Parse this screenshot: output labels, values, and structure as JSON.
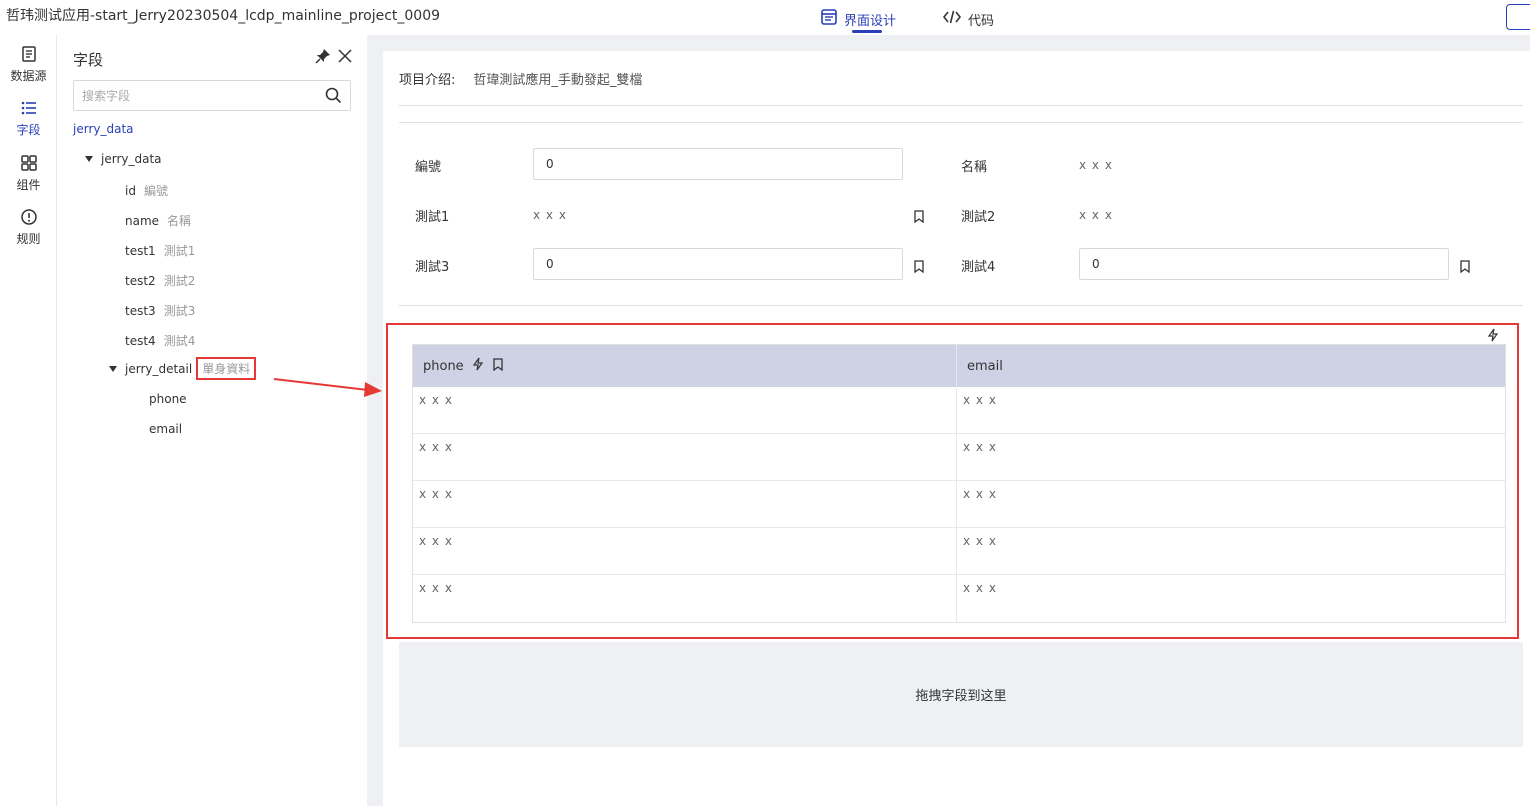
{
  "app": {
    "title": "哲玮测试应用-start_Jerry20230504_lcdp_mainline_project_0009",
    "tabs": [
      {
        "label": "界面设计",
        "active": true,
        "icon": "layout-icon"
      },
      {
        "label": "代码",
        "active": false,
        "icon": "code-icon"
      }
    ]
  },
  "rail": {
    "items": [
      {
        "label": "数据源",
        "icon": "datasource-icon",
        "active": false
      },
      {
        "label": "字段",
        "icon": "list-icon",
        "active": true
      },
      {
        "label": "组件",
        "icon": "grid-icon",
        "active": false
      },
      {
        "label": "规则",
        "icon": "alert-circle-icon",
        "active": false
      }
    ]
  },
  "fields_panel": {
    "title": "字段",
    "search_placeholder": "搜索字段",
    "root": "jerry_data",
    "tree": {
      "group": "jerry_data",
      "items": [
        {
          "key": "id",
          "label": "編號"
        },
        {
          "key": "name",
          "label": "名稱"
        },
        {
          "key": "test1",
          "label": "測試1"
        },
        {
          "key": "test2",
          "label": "測試2"
        },
        {
          "key": "test3",
          "label": "測試3"
        },
        {
          "key": "test4",
          "label": "測試4"
        }
      ],
      "detail": {
        "key": "jerry_detail",
        "label": "單身資料",
        "children": [
          "phone",
          "email"
        ]
      }
    }
  },
  "form": {
    "intro_label": "项目介绍:",
    "intro_value": "哲瑋測試應用_手動發起_雙檔",
    "fields": {
      "id_label": "編號",
      "id_value": "0",
      "name_label": "名稱",
      "name_value": "x x x",
      "test1_label": "測試1",
      "test1_value": "x x x",
      "test2_label": "測試2",
      "test2_value": "x x x",
      "test3_label": "測試3",
      "test3_value": "0",
      "test4_label": "測試4",
      "test4_value": "0"
    }
  },
  "table": {
    "columns": [
      "phone",
      "email"
    ],
    "rows": [
      [
        "x x x",
        "x x x"
      ],
      [
        "x x x",
        "x x x"
      ],
      [
        "x x x",
        "x x x"
      ],
      [
        "x x x",
        "x x x"
      ],
      [
        "x x x",
        "x x x"
      ]
    ]
  },
  "dropzone": {
    "text": "拖拽字段到这里"
  },
  "colors": {
    "accent": "#2a3fb7",
    "highlight": "#e53935",
    "table_header": "#cfd1e4",
    "canvas_bg": "#eef0f4"
  }
}
